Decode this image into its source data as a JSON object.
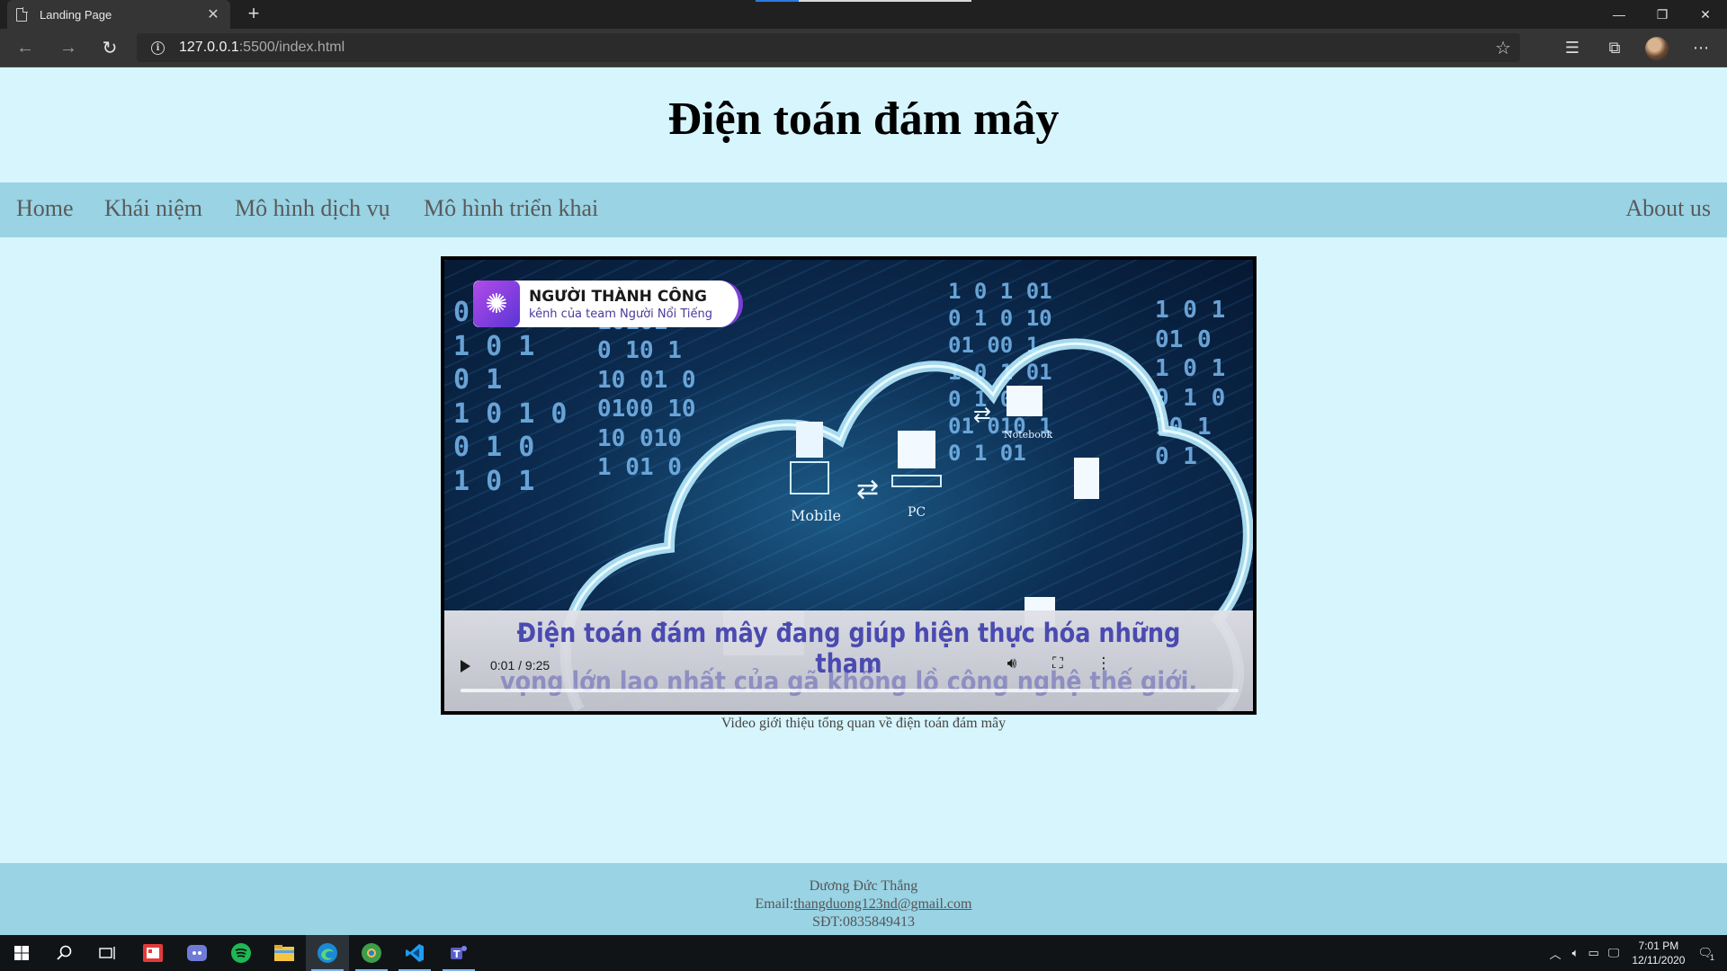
{
  "browser": {
    "tab_title": "Landing Page",
    "url_host": "127.0.0.1",
    "url_rest": ":5500/index.html"
  },
  "page": {
    "title": "Điện toán đám mây",
    "nav": {
      "home": "Home",
      "khai_niem": "Khái niệm",
      "mo_hinh_dich_vu": "Mô hình dịch vụ",
      "mo_hinh_trien_khai": "Mô hình triển khai",
      "about": "About us"
    },
    "video": {
      "channel_name": "NGƯỜI THÀNH CÔNG",
      "channel_sub": "kênh của team Người Nổi Tiếng",
      "subtitle_line1": "Điện toán đám mây đang giúp hiện thực hóa những tham",
      "subtitle_line2": "vọng lớn lao nhất của gã khổng lồ công nghệ thế giới.",
      "labels": {
        "mobile": "Mobile",
        "pc": "PC",
        "notebook": "Notebook"
      },
      "time": "0:01 / 9:25",
      "progress": 0.0018
    },
    "caption": "Video giới thiệu tổng quan về điện toán đám mây",
    "footer": {
      "name": "Dương Đức Thắng",
      "email_label": "Email:",
      "email": "thangduong123nd@gmail.com",
      "phone": "SĐT:0835849413"
    }
  },
  "taskbar": {
    "time": "7:01 PM",
    "date": "12/11/2020",
    "notification_count": "1",
    "apps": [
      "start-icon",
      "search-icon",
      "task-view-icon",
      "news-app-icon",
      "discord-icon",
      "spotify-icon",
      "file-explorer-icon",
      "edge-icon",
      "chrome-canary-icon",
      "vscode-icon",
      "teams-icon"
    ]
  }
}
